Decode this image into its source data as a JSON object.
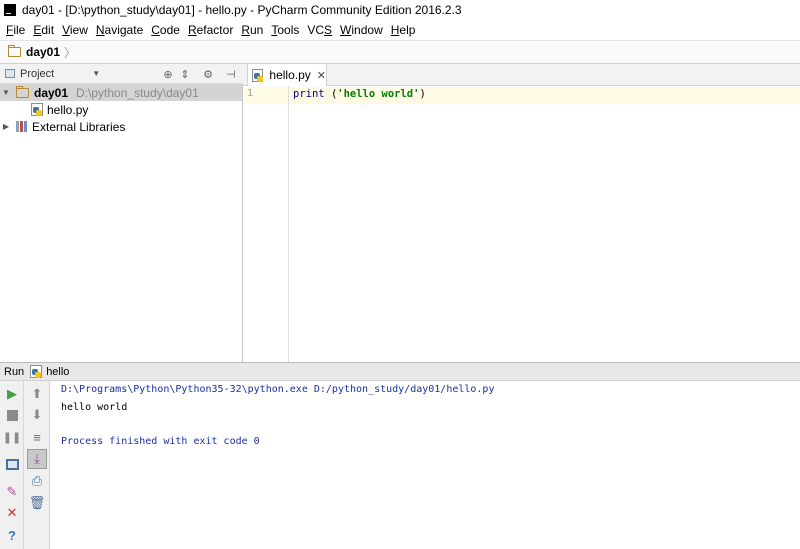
{
  "window": {
    "title": "day01 - [D:\\python_study\\day01] - hello.py - PyCharm Community Edition 2016.2.3"
  },
  "menu": [
    {
      "label": "File",
      "mnemonic": "F",
      "rest": "ile"
    },
    {
      "label": "Edit",
      "mnemonic": "E",
      "rest": "dit"
    },
    {
      "label": "View",
      "mnemonic": "V",
      "rest": "iew"
    },
    {
      "label": "Navigate",
      "mnemonic": "N",
      "rest": "avigate"
    },
    {
      "label": "Code",
      "mnemonic": "C",
      "rest": "ode"
    },
    {
      "label": "Refactor",
      "mnemonic": "R",
      "rest": "efactor"
    },
    {
      "label": "Run",
      "mnemonic": "R",
      "rest": "un"
    },
    {
      "label": "Tools",
      "mnemonic": "T",
      "rest": "ools"
    },
    {
      "label": "VCS",
      "mnemonic": "S",
      "rest": "VC"
    },
    {
      "label": "Window",
      "mnemonic": "W",
      "rest": "indow"
    },
    {
      "label": "Help",
      "mnemonic": "H",
      "rest": "elp"
    }
  ],
  "navbar": {
    "crumb": "day01"
  },
  "project_panel": {
    "view_label": "Project",
    "root": {
      "name": "day01",
      "path": "D:\\python_study\\day01"
    },
    "file": "hello.py",
    "external": "External Libraries"
  },
  "editor": {
    "tab": "hello.py",
    "line_number": "1",
    "code_kw": "print ",
    "code_open": "(",
    "code_str": "'hello world'",
    "code_close": ")"
  },
  "run": {
    "label": "Run",
    "config": "hello",
    "cmd": "D:\\Programs\\Python\\Python35-32\\python.exe D:/python_study/day01/hello.py",
    "output": "hello world",
    "exit": "Process finished with exit code 0"
  },
  "colors": {
    "run_green": "#3fa33f",
    "close_red": "#d43030",
    "help_blue": "#3b73c8",
    "console_blue": "#1a30a0",
    "string_green": "#008000"
  }
}
